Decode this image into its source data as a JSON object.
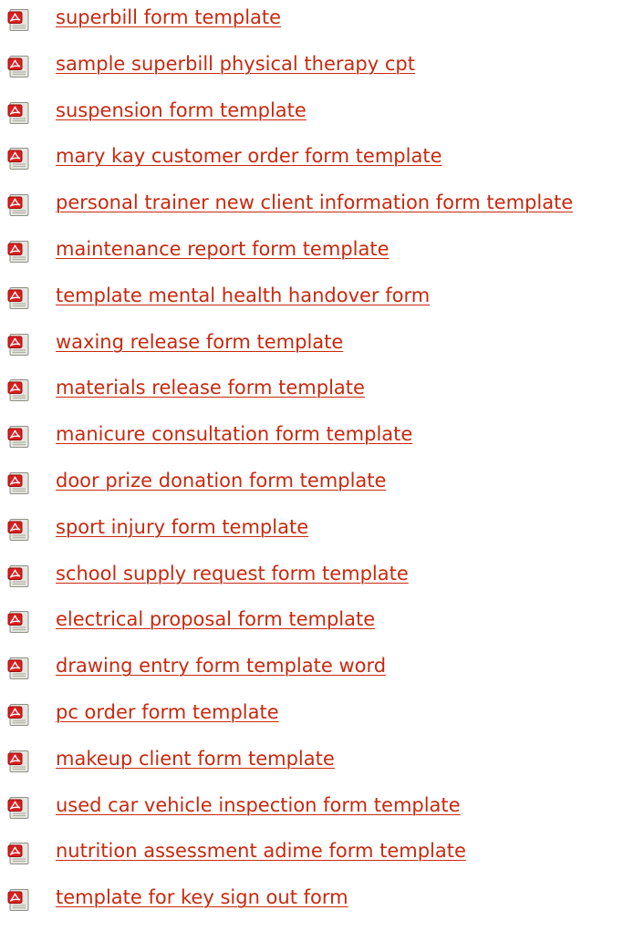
{
  "colors": {
    "link": "#c8290f",
    "icon_red": "#d81e1e",
    "icon_paper": "#d4d4cc"
  },
  "icon": "pdf-document-icon",
  "items": [
    {
      "label": "superbill form template"
    },
    {
      "label": "sample superbill physical therapy cpt"
    },
    {
      "label": "suspension form template"
    },
    {
      "label": "mary kay customer order form template"
    },
    {
      "label": "personal trainer new client information form template"
    },
    {
      "label": "maintenance report form template"
    },
    {
      "label": "template mental health handover form"
    },
    {
      "label": "waxing release form template"
    },
    {
      "label": "materials release form template"
    },
    {
      "label": "manicure consultation form template"
    },
    {
      "label": "door prize donation form template"
    },
    {
      "label": "sport injury form template"
    },
    {
      "label": "school supply request form template"
    },
    {
      "label": "electrical proposal form template"
    },
    {
      "label": "drawing entry form template word"
    },
    {
      "label": "pc order form template"
    },
    {
      "label": "makeup client form template"
    },
    {
      "label": "used car vehicle inspection form template"
    },
    {
      "label": "nutrition assessment adime form template"
    },
    {
      "label": "template for key sign out form"
    }
  ]
}
